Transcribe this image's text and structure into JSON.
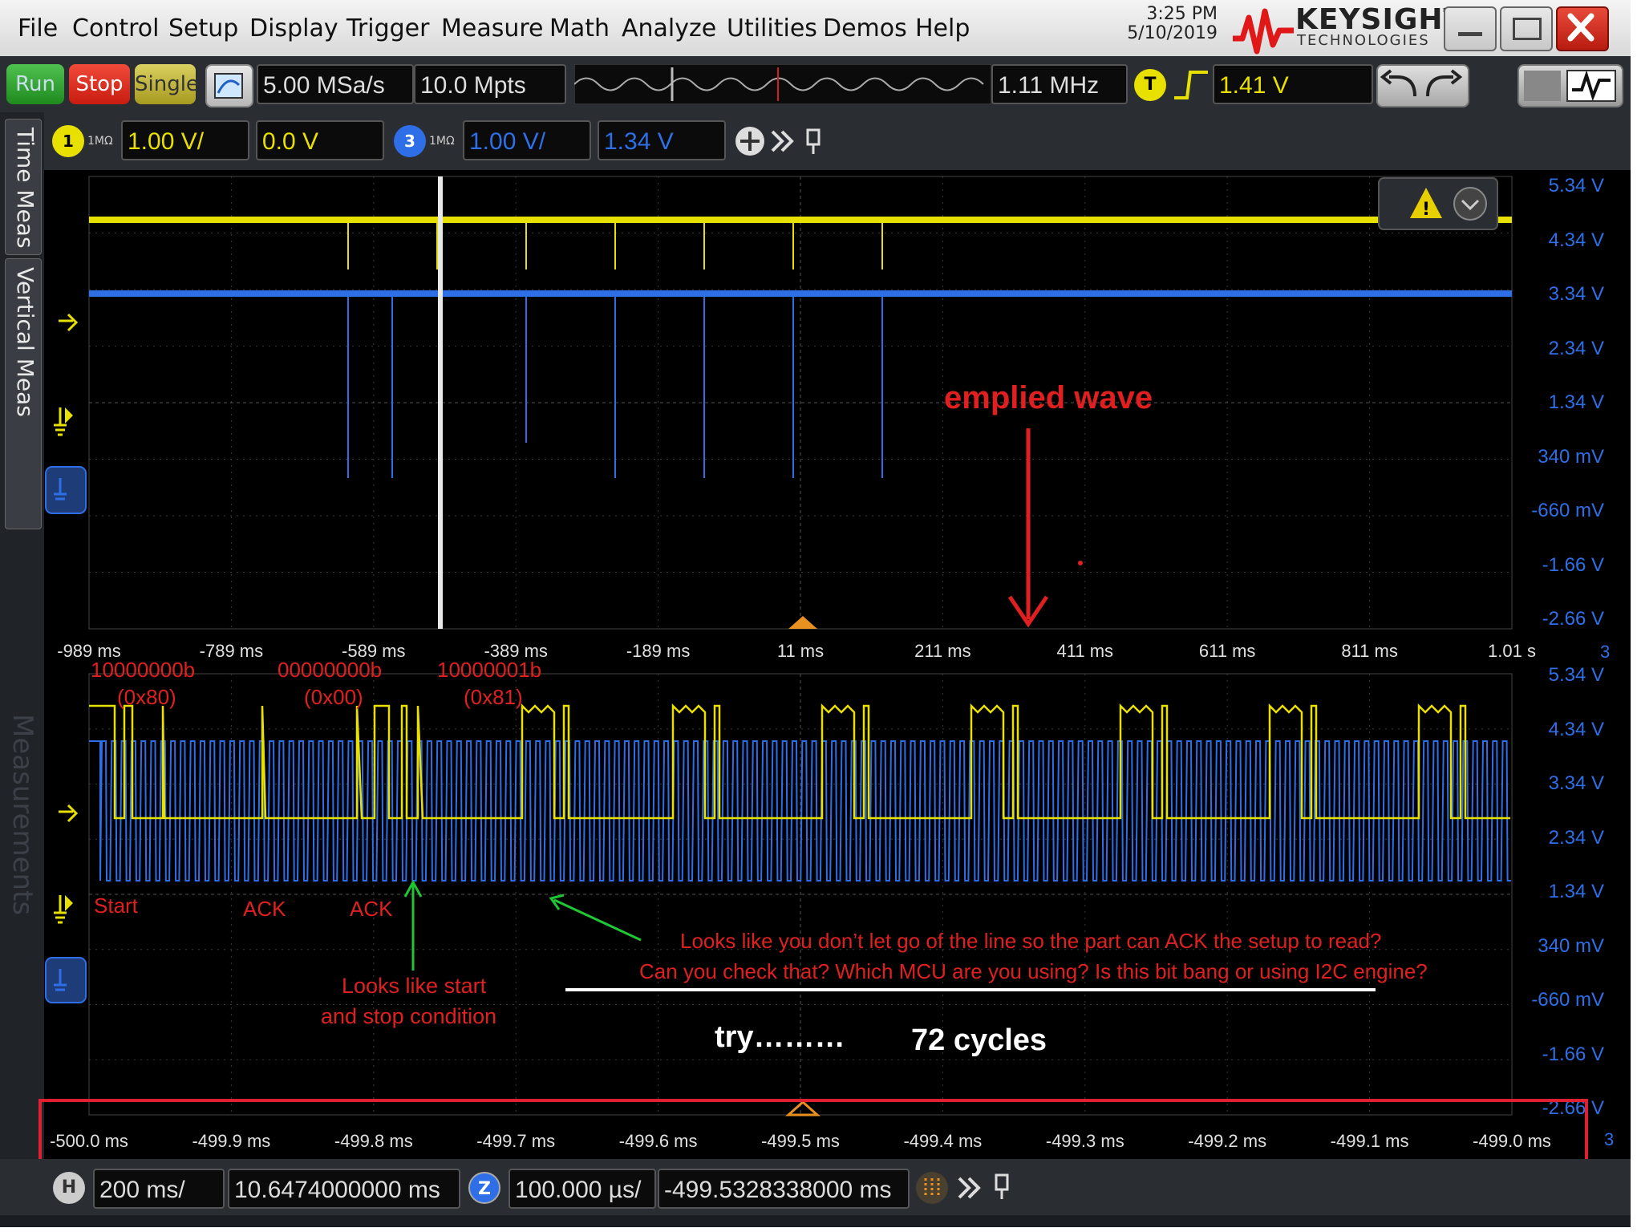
{
  "menu": [
    "File",
    "Control",
    "Setup",
    "Display",
    "Trigger",
    "Measure",
    "Math",
    "Analyze",
    "Utilities",
    "Demos",
    "Help"
  ],
  "clock": {
    "time": "3:25 PM",
    "date": "5/10/2019"
  },
  "brand": {
    "name": "KEYSIGHT",
    "sub": "TECHNOLOGIES"
  },
  "toolbar": {
    "run": "Run",
    "stop": "Stop",
    "single": "Single",
    "sample_rate": "5.00 MSa/s",
    "memory_depth": "10.0 Mpts",
    "frequency": "1.11 MHz",
    "trigger_badge": "T",
    "trigger_level": "1.41 V"
  },
  "channels": [
    {
      "badge": "1",
      "impedance": "1MΩ",
      "scale": "1.00 V/",
      "offset": "0.0 V",
      "color": "#e8e000"
    },
    {
      "badge": "3",
      "impedance": "1MΩ",
      "scale": "1.00 V/",
      "offset": "1.34 V",
      "color": "#2e6fe8"
    }
  ],
  "sidebar": {
    "tab1": "Time Meas",
    "tab2": "Vertical Meas",
    "watermark": "Measurements"
  },
  "upper_plot": {
    "y_labels": [
      "5.34 V",
      "4.34 V",
      "3.34 V",
      "2.34 V",
      "1.34 V",
      "340 mV",
      "-660 mV",
      "-1.66 V",
      "-2.66 V"
    ],
    "x_labels": [
      "-989 ms",
      "-789 ms",
      "-589 ms",
      "-389 ms",
      "-189 ms",
      "11 ms",
      "211 ms",
      "411 ms",
      "611 ms",
      "811 ms",
      "1.01 s"
    ],
    "channel_tag": "3",
    "annotation": "emplied wave"
  },
  "lower_plot": {
    "y_labels": [
      "5.34 V",
      "4.34 V",
      "3.34 V",
      "2.34 V",
      "1.34 V",
      "340 mV",
      "-660 mV",
      "-1.66 V",
      "-2.66 V"
    ],
    "x_labels": [
      "-500.0 ms",
      "-499.9 ms",
      "-499.8 ms",
      "-499.7 ms",
      "-499.6 ms",
      "-499.5 ms",
      "-499.4 ms",
      "-499.3 ms",
      "-499.2 ms",
      "-499.1 ms",
      "-499.0 ms"
    ],
    "channel_tag": "3",
    "annotations": {
      "byte1_bin": "10000000b",
      "byte1_hex": "(0x80)",
      "byte2_bin": "00000000b",
      "byte2_hex": "(0x00)",
      "byte3_bin": "10000001b",
      "byte3_hex": "(0x81)",
      "start": "Start",
      "ack1": "ACK",
      "ack2": "ACK",
      "start_stop_line1": "Looks like start",
      "start_stop_line2": "and stop condition",
      "comment_line1": "Looks like you don’t let go of the line so the part can ACK the setup to read?",
      "comment_line2": "Can you check that? Which MCU are you using? Is this bit bang or using I2C engine?",
      "try": "try………",
      "cycles": "72 cycles"
    }
  },
  "bottom": {
    "h_badge": "H",
    "timebase": "200 ms/",
    "position": "10.6474000000 ms",
    "zoom_badge": "Z",
    "zoom_timebase": "100.000 µs/",
    "zoom_position": "-499.5328338000 ms"
  },
  "colors": {
    "ch1": "#e8e000",
    "ch3": "#2e6fe8",
    "annotation_red": "#e02020",
    "arrow_green": "#1ec832",
    "highlight_box": "#e02030"
  }
}
